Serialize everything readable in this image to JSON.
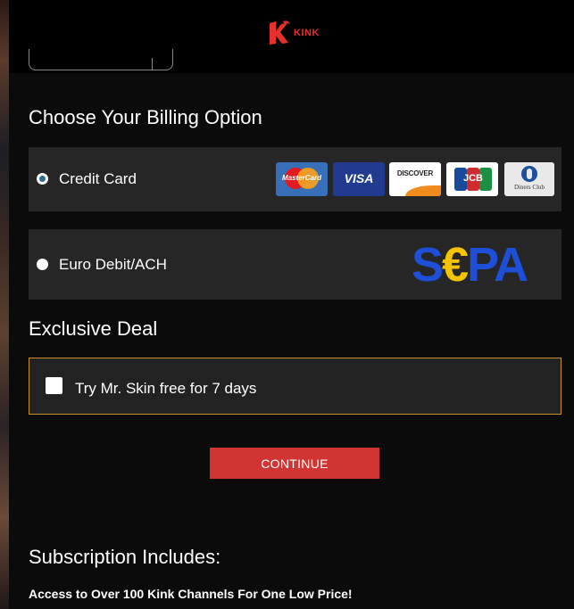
{
  "header": {
    "logo_text": "KINK",
    "logo_color": "#e5302c"
  },
  "billing": {
    "title": "Choose Your Billing Option",
    "options": [
      {
        "label": "Credit Card",
        "selected": true,
        "cards": [
          {
            "name": "MasterCard",
            "icon": "mastercard-logo"
          },
          {
            "name": "VISA",
            "icon": "visa-logo"
          },
          {
            "name": "DISCOVER",
            "icon": "discover-logo"
          },
          {
            "name": "JCB",
            "icon": "jcb-logo"
          },
          {
            "name": "Diners Club",
            "icon": "diners-club-logo"
          }
        ]
      },
      {
        "label": "Euro Debit/ACH",
        "selected": false,
        "logo": {
          "s": "S",
          "euro": "€",
          "pa": "PA"
        }
      }
    ]
  },
  "exclusive": {
    "title": "Exclusive Deal",
    "checkbox_label": "Try Mr. Skin free for 7 days",
    "checked": false,
    "border_color": "#c7902a"
  },
  "continue_label": "CONTINUE",
  "continue_color": "#d03433",
  "subscription": {
    "title": "Subscription Includes:",
    "line1": "Access to Over 100 Kink Channels For One Low Price!"
  }
}
